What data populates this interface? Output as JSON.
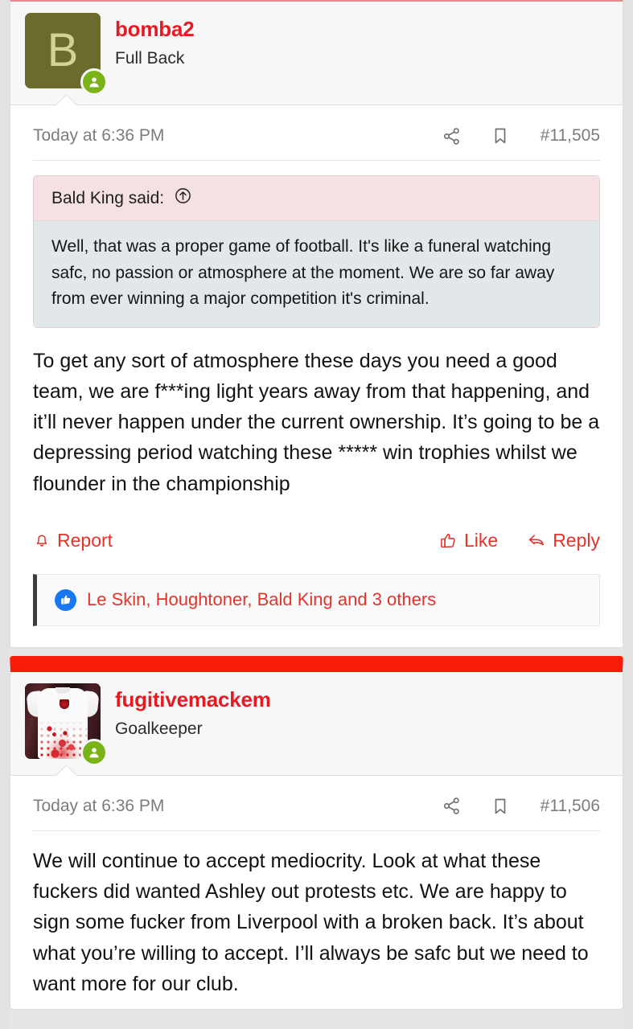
{
  "theme": {
    "accent_red": "#e31b23",
    "action_red": "#e1352c",
    "divider_red": "#f81c06",
    "online_green": "#7ab317",
    "like_blue": "#1878f3",
    "quote_head_bg": "#f5e1e3",
    "quote_body_bg": "#e2e7ea",
    "avatar_olive": "#6b6b2e"
  },
  "posts": [
    {
      "author": "bomba2",
      "user_title": "Full Back",
      "avatar_kind": "letter",
      "avatar_letter": "B",
      "online_status": "online",
      "timestamp": "Today at 6:36 PM",
      "post_number": "#11,505",
      "share_icon": "share-nodes-icon",
      "bookmark_icon": "bookmark-icon",
      "quote": {
        "attribution": "Bald King said:",
        "jump_icon": "circle-arrow-up-icon",
        "text": "Well, that was a proper game of football. It's like a funeral watching safc, no passion or atmosphere at the moment. We are so far away from ever winning a major competition it's criminal."
      },
      "message": "To get any sort of atmosphere these days you need a good team, we are f***ing light years away from that happening, and it’ll never happen under the current ownership. It’s going to be a depressing period watching these ***** win trophies whilst we flounder in the championship",
      "actions": {
        "report_label": "Report",
        "report_icon": "bell-icon",
        "like_label": "Like",
        "like_icon": "thumbs-up-icon",
        "reply_label": "Reply",
        "reply_icon": "reply-arrow-icon"
      },
      "likes": {
        "badge_icon": "thumbs-up-filled-icon",
        "text": "Le Skin, Houghtoner, Bald King and 3 others"
      }
    },
    {
      "author": "fugitivemackem",
      "user_title": "Goalkeeper",
      "avatar_kind": "photo",
      "avatar_photo_desc": "sunderland-shirt-photo",
      "online_status": "online",
      "timestamp": "Today at 6:36 PM",
      "post_number": "#11,506",
      "share_icon": "share-nodes-icon",
      "bookmark_icon": "bookmark-icon",
      "message": "We will continue to accept mediocrity. Look at what these fuckers did wanted Ashley out protests etc. We are happy to sign some fucker from Liverpool with a broken back. It’s about what you’re willing to accept. I’ll always be safc but we need to want more for our club."
    }
  ]
}
